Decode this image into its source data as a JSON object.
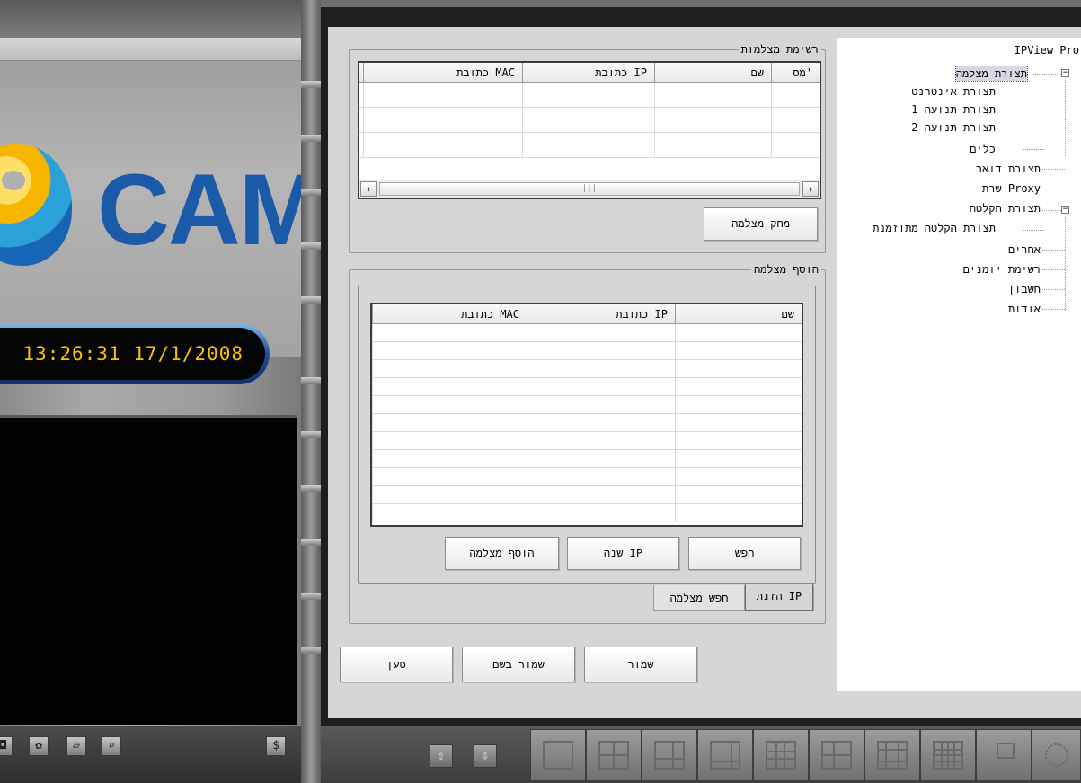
{
  "left_panel": {
    "logo_text": "CAM",
    "clock": "13:26:31 17/1/2008",
    "bottom_icons": [
      "camera-icon",
      "settings-icon",
      "folder-icon",
      "search-icon",
      "dollar-icon"
    ]
  },
  "camera_list": {
    "title": "רשימת מצלמות",
    "columns": [
      "מס'",
      "שם",
      "כתובת IP",
      "כתובת MAC"
    ],
    "delete_button": "מחק מצלמה"
  },
  "add_camera": {
    "title": "הוסף מצלמה",
    "columns": [
      "שם",
      "כתובת IP",
      "כתובת MAC"
    ],
    "search_button": "חפש",
    "change_ip_button": "שנה IP",
    "add_button": "הוסף מצלמה",
    "tabs": [
      "הזנת IP",
      "חפש מצלמה"
    ]
  },
  "footer_buttons": {
    "save": "שמור",
    "save_as": "שמור בשם",
    "load": "טען"
  },
  "tree": {
    "root": "IPView Pro",
    "items": [
      "תצורת מצלמה",
      "תצורת אינטרנט",
      "תצורת תנועה-1",
      "תצורת תנועה-2",
      "כלים",
      "תצורת דואר",
      "שרת Proxy",
      "תצורת הקלטה",
      "תצורת הקלטה מתוזמנת",
      "אחרים",
      "רשימת יומנים",
      "חשבון",
      "אודות"
    ]
  },
  "colors": {
    "logo_blue": "#1b5aa8",
    "clock_text": "#f5c400",
    "dialog_bg": "#d6d6d6"
  }
}
